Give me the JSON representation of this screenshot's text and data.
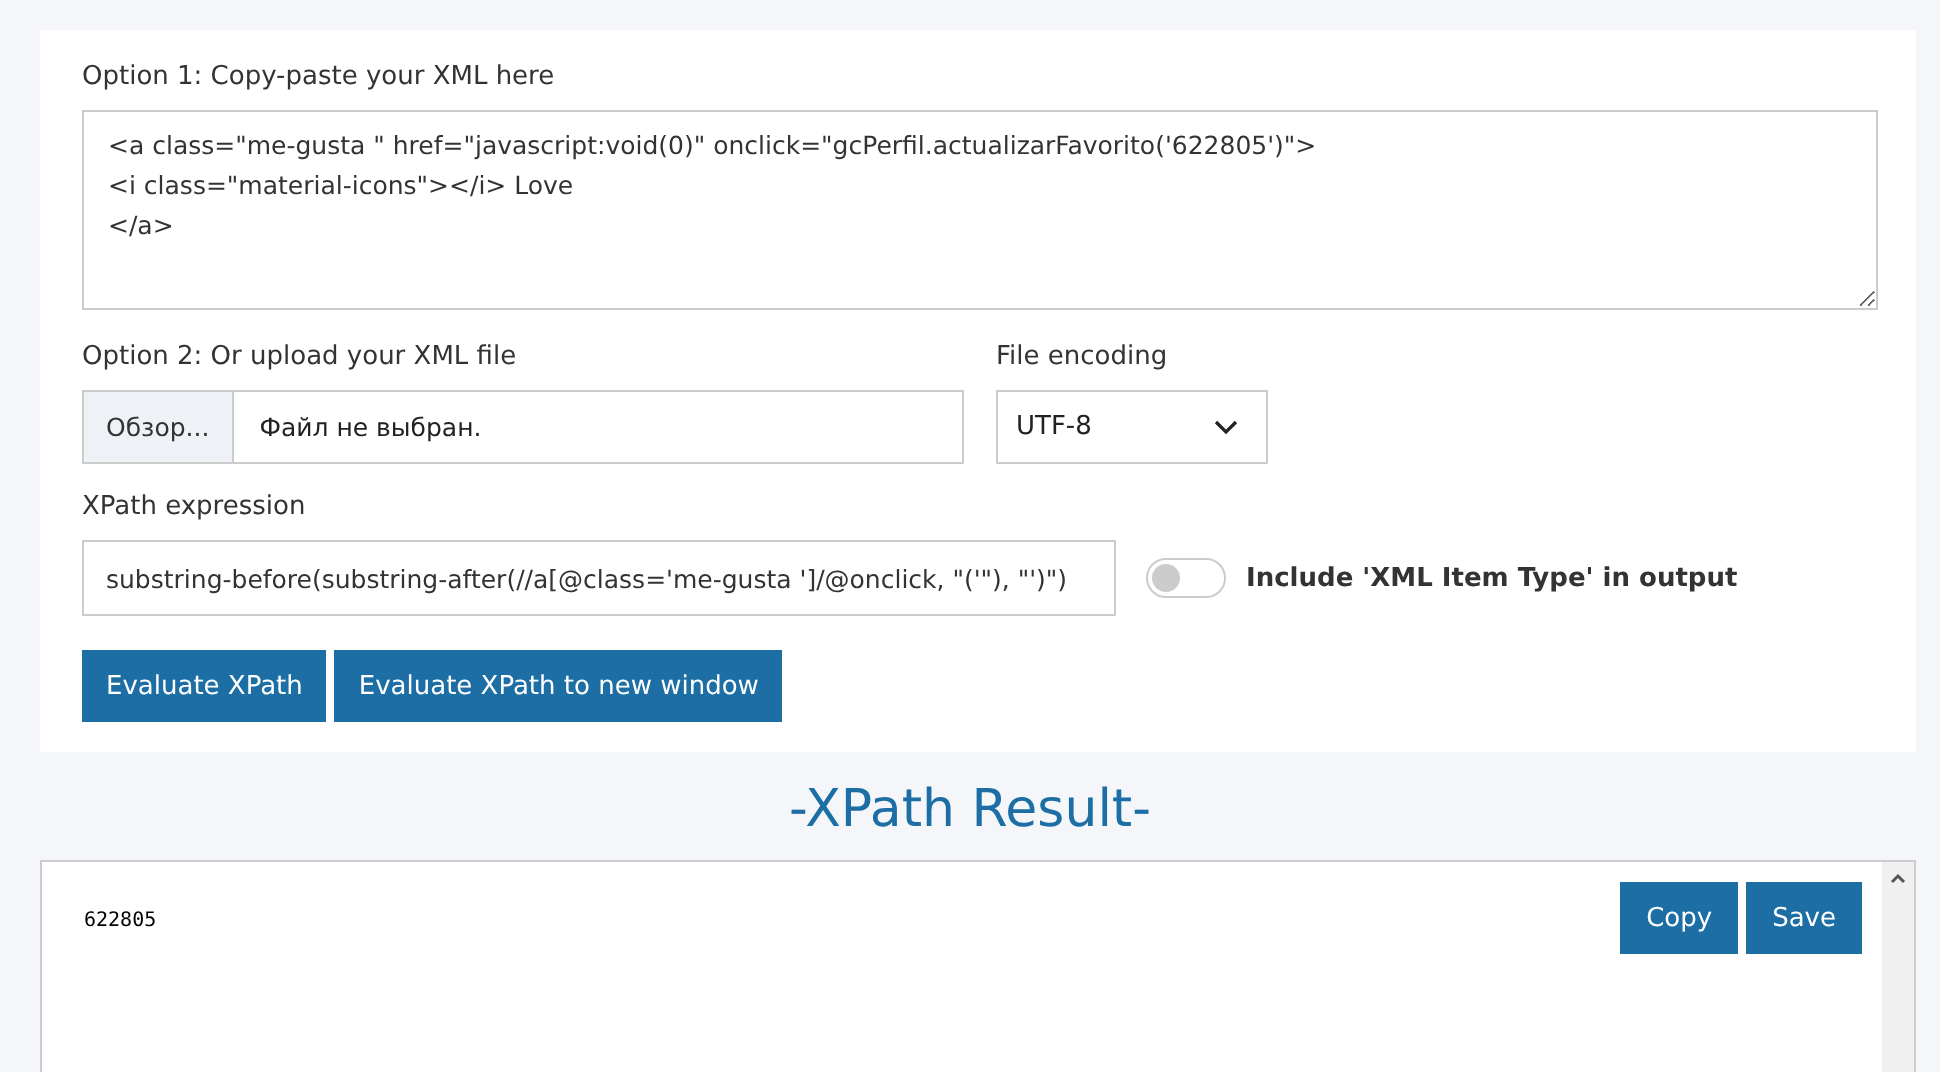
{
  "xml_input": {
    "label": "Option 1: Copy-paste your XML here",
    "lines": [
      "<a class=\"me-gusta \" href=\"javascript:void(0)\" onclick=\"gcPerfil.actualizarFavorito('622805')\">",
      "<i class=\"material-icons\"></i> Love",
      "</a>"
    ]
  },
  "upload": {
    "label": "Option 2: Or upload your XML file",
    "browse_button": "Обзор...",
    "file_status": "Файл не выбран."
  },
  "encoding": {
    "label": "File encoding",
    "value": "UTF-8"
  },
  "xpath": {
    "label": "XPath expression",
    "value": "substring-before(substring-after(//a[@class='me-gusta ']/@onclick, \"('\"), \"')\")"
  },
  "include_item_type": {
    "label": "Include 'XML Item Type' in output",
    "on": false
  },
  "buttons": [
    "Evaluate XPath",
    "Evaluate XPath to new window"
  ],
  "result": {
    "title": "-XPath Result-",
    "output": "622805",
    "buttons": [
      "Copy",
      "Save"
    ]
  }
}
